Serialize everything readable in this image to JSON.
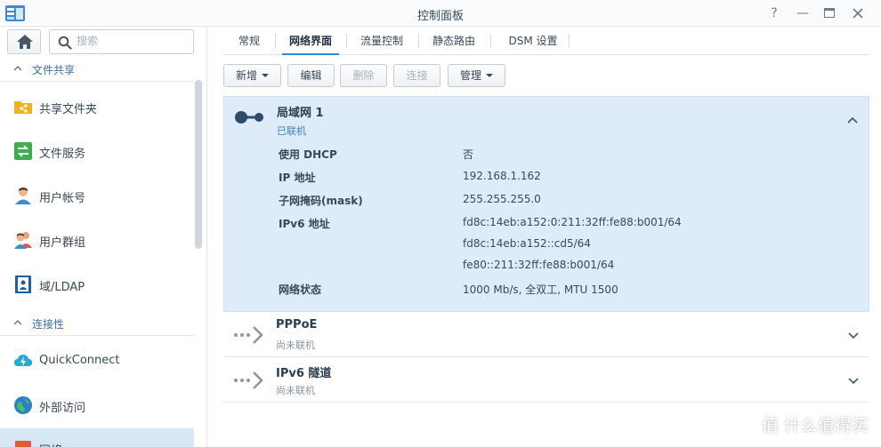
{
  "window": {
    "title": "控制面板"
  },
  "sidebar": {
    "search_placeholder": "搜索",
    "sections": [
      {
        "label": "文件共享"
      },
      {
        "label": "连接性"
      }
    ],
    "items": [
      {
        "label": "共享文件夹",
        "icon": "shared-folder-icon"
      },
      {
        "label": "文件服务",
        "icon": "file-services-icon"
      },
      {
        "label": "用户帐号",
        "icon": "user-icon"
      },
      {
        "label": "用户群组",
        "icon": "group-icon"
      },
      {
        "label": "域/LDAP",
        "icon": "domain-ldap-icon"
      },
      {
        "label": "QuickConnect",
        "icon": "quickconnect-icon"
      },
      {
        "label": "外部访问",
        "icon": "external-access-icon"
      },
      {
        "label": "网络",
        "icon": "network-icon"
      }
    ]
  },
  "tabs": [
    {
      "label": "常规"
    },
    {
      "label": "网络界面",
      "active": true
    },
    {
      "label": "流量控制"
    },
    {
      "label": "静态路由"
    },
    {
      "label": "DSM 设置"
    }
  ],
  "toolbar": {
    "create": "新增",
    "edit": "编辑",
    "delete": "删除",
    "connect": "连接",
    "manage": "管理"
  },
  "interfaces": {
    "lan": {
      "name": "局域网 1",
      "status": "已联机",
      "details": {
        "dhcp_label": "使用 DHCP",
        "dhcp_value": "否",
        "ip_label": "IP 地址",
        "ip_value": "192.168.1.162",
        "mask_label": "子网掩码(mask)",
        "mask_value": "255.255.255.0",
        "ipv6_label": "IPv6 地址",
        "ipv6_values": [
          "fd8c:14eb:a152:0:211:32ff:fe88:b001/64",
          "fd8c:14eb:a152::cd5/64",
          "fe80::211:32ff:fe88:b001/64"
        ],
        "netstatus_label": "网络状态",
        "netstatus_value": "1000 Mb/s, 全双工, MTU 1500"
      }
    },
    "pppoe": {
      "name": "PPPoE",
      "status": "尚未联机"
    },
    "ipv6tunnel": {
      "name": "IPv6 隧道",
      "status": "尚未联机"
    }
  },
  "watermark": "值 什么值得买",
  "colors": {
    "accent": "#2d8ae2",
    "selected_bg": "#deebf8",
    "link": "#3c6f9c"
  }
}
